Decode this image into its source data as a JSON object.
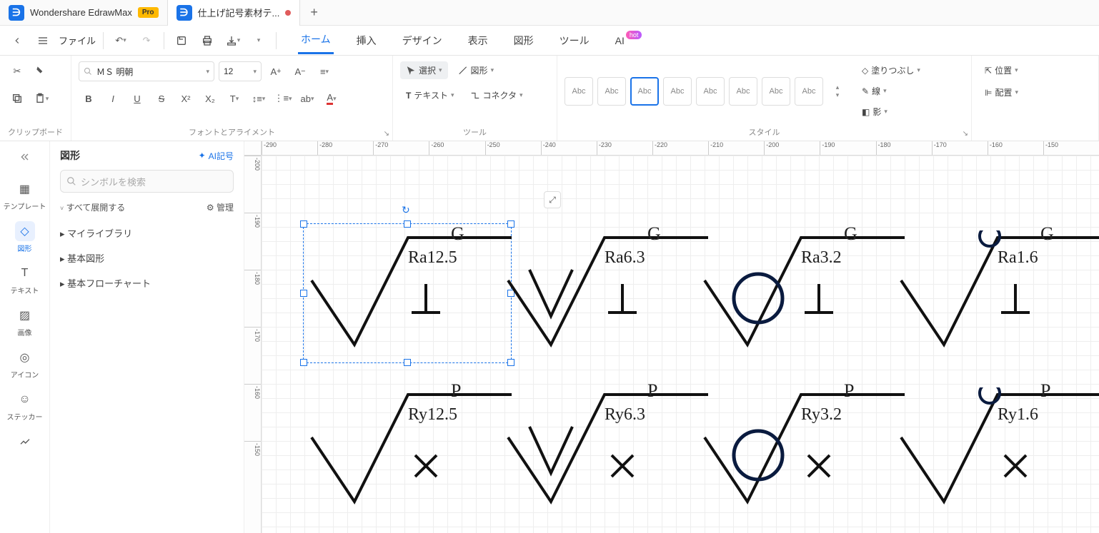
{
  "app": {
    "title": "Wondershare EdrawMax",
    "badge": "Pro"
  },
  "tab": {
    "title": "仕上げ記号素材テ...",
    "modified": true
  },
  "menu": {
    "file": "ファイル",
    "tabs": [
      "ホーム",
      "挿入",
      "デザイン",
      "表示",
      "図形",
      "ツール",
      "AI"
    ],
    "active": 0,
    "hot_badge": "hot"
  },
  "ribbon": {
    "clipboard_label": "クリップボード",
    "font_label": "フォントとアライメント",
    "tool_label": "ツール",
    "style_label": "スタイル",
    "font_name": "ＭＳ 明朝",
    "font_size": "12",
    "select_label": "選択",
    "shape_label": "図形",
    "text_label": "テキスト",
    "connector_label": "コネクタ",
    "style_swatch": "Abc",
    "fill_label": "塗りつぶし",
    "line_label": "線",
    "shadow_label": "影",
    "position_label": "位置",
    "arrange_label": "配置"
  },
  "leftbar": {
    "template": "テンプレート",
    "shapes": "図形",
    "text": "テキスト",
    "image": "画像",
    "icon": "アイコン",
    "sticker": "ステッカー"
  },
  "sidepanel": {
    "title": "図形",
    "ai_link": "AI記号",
    "search_placeholder": "シンボルを検索",
    "expand_all": "すべて展開する",
    "manage": "管理",
    "groups": [
      "マイライブラリ",
      "基本図形",
      "基本フローチャート"
    ]
  },
  "ruler": {
    "h": [
      "-290",
      "-280",
      "-270",
      "-260",
      "-250",
      "-240",
      "-230",
      "-220",
      "-210",
      "-200",
      "-190",
      "-180",
      "-170",
      "-160",
      "-150"
    ],
    "v": [
      "-200",
      "-190",
      "-180",
      "-170",
      "-160",
      "-150"
    ]
  },
  "shapes": {
    "row1": [
      {
        "letter": "G",
        "label": "Ra12.5",
        "lay": "removal"
      },
      {
        "letter": "G",
        "label": "Ra6.3",
        "lay": "triangle"
      },
      {
        "letter": "G",
        "label": "Ra3.2",
        "lay": "circle-big"
      },
      {
        "letter": "G",
        "label": "Ra1.6",
        "lay": "circle-small"
      }
    ],
    "row2": [
      {
        "letter": "P",
        "label": "Ry12.5",
        "lay": "removal",
        "mark": "x"
      },
      {
        "letter": "P",
        "label": "Ry6.3",
        "lay": "triangle",
        "mark": "x"
      },
      {
        "letter": "P",
        "label": "Ry3.2",
        "lay": "circle-big",
        "mark": "x"
      },
      {
        "letter": "P",
        "label": "Ry1.6",
        "lay": "circle-small",
        "mark": "x"
      }
    ]
  }
}
